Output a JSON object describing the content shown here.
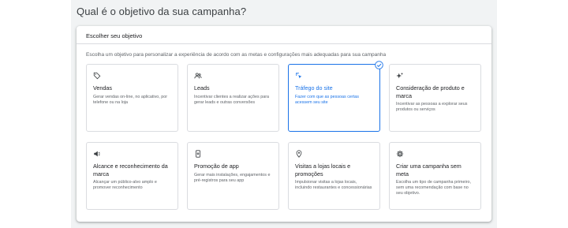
{
  "page": {
    "title": "Qual é o objetivo da sua campanha?"
  },
  "panel": {
    "header": "Escolher seu objetivo",
    "description": "Escolha um objetivo para personalizar a experiência de acordo com as metas e configurações mais adequadas para sua campanha"
  },
  "colors": {
    "accent": "#1a73e8",
    "border": "#dadce0",
    "text": "#202124",
    "muted": "#5f6368"
  },
  "cards": [
    {
      "icon": "tag-icon",
      "title": "Vendas",
      "desc": "Gerar vendas on-line, no aplicativo, por telefone ou na loja",
      "selected": false
    },
    {
      "icon": "people-icon",
      "title": "Leads",
      "desc": "Incentivar clientes a realizar ações para gerar leads e outras conversões",
      "selected": false
    },
    {
      "icon": "cursor-click-icon",
      "title": "Tráfego do site",
      "desc": "Fazer com que as pessoas certas acessem seu site",
      "selected": true
    },
    {
      "icon": "sparkle-icon",
      "title": "Consideração de produto e marca",
      "desc": "Incentivar as pessoas a explorar seus produtos ou serviços",
      "selected": false
    },
    {
      "icon": "megaphone-icon",
      "title": "Alcance e reconhecimento da marca",
      "desc": "Alcançar um público-alvo amplo e promover reconhecimento",
      "selected": false
    },
    {
      "icon": "phone-icon",
      "title": "Promoção de app",
      "desc": "Gerar mais instalações, engajamentos e pré-registros para seu app",
      "selected": false
    },
    {
      "icon": "location-pin-icon",
      "title": "Visitas a lojas locais e promoções",
      "desc": "Impulsionar visitas a lojas locais, incluindo restaurantes e concessionárias",
      "selected": false
    },
    {
      "icon": "gear-icon",
      "title": "Criar uma campanha sem meta",
      "desc": "Escolha um tipo de campanha primeiro, sem uma recomendação com base no seu objetivo.",
      "selected": false
    }
  ]
}
